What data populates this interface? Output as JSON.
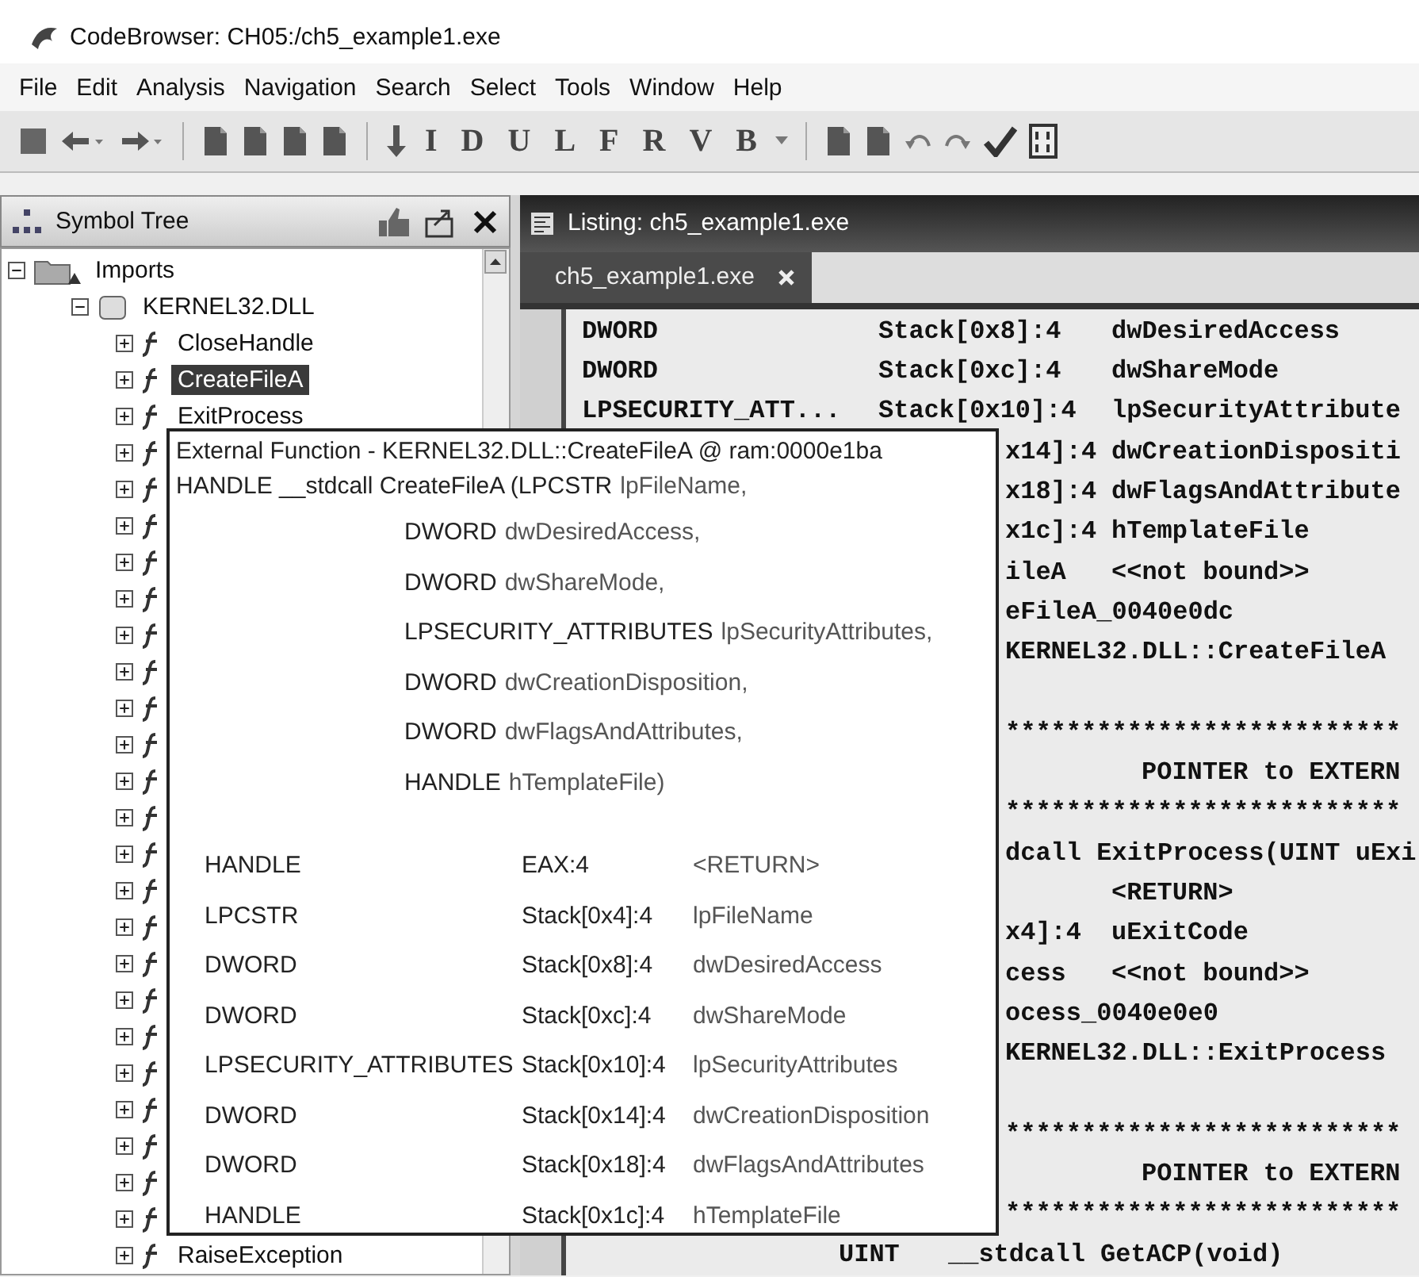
{
  "window": {
    "title": "CodeBrowser: CH05:/ch5_example1.exe"
  },
  "menu": [
    "File",
    "Edit",
    "Analysis",
    "Navigation",
    "Search",
    "Select",
    "Tools",
    "Window",
    "Help"
  ],
  "toolbar": {
    "letters": [
      "I",
      "D",
      "U",
      "L",
      "F",
      "R",
      "V",
      "B"
    ]
  },
  "symbol_tree": {
    "title": "Symbol Tree",
    "items": [
      {
        "label": "Imports",
        "expanded": true,
        "selected": false,
        "children": [
          {
            "label": "KERNEL32.DLL",
            "expanded": true,
            "selected": false,
            "children": [
              {
                "label": "CloseHandle",
                "expanded": false,
                "selected": false
              },
              {
                "label": "CreateFileA",
                "expanded": false,
                "selected": true
              },
              {
                "label": "ExitProcess",
                "expanded": false,
                "selected": false
              },
              {
                "expanded": false
              },
              {
                "expanded": false
              },
              {
                "expanded": false
              },
              {
                "expanded": false
              },
              {
                "expanded": false
              },
              {
                "expanded": false
              },
              {
                "expanded": false
              },
              {
                "expanded": false
              },
              {
                "expanded": false
              },
              {
                "expanded": false
              },
              {
                "expanded": false
              },
              {
                "expanded": false
              },
              {
                "expanded": false
              },
              {
                "expanded": false
              },
              {
                "expanded": false
              },
              {
                "expanded": false
              },
              {
                "expanded": false
              },
              {
                "expanded": false
              },
              {
                "expanded": false
              },
              {
                "expanded": false
              },
              {
                "expanded": false
              },
              {
                "expanded": false
              },
              {
                "label": "RaiseException",
                "expanded": false,
                "selected": false
              }
            ]
          }
        ]
      }
    ]
  },
  "listing": {
    "title": "Listing:  ch5_example1.exe",
    "tabs": [
      {
        "label": "ch5_example1.exe",
        "selected": true
      }
    ],
    "lines": [
      {
        "kind": "param",
        "type": "DWORD",
        "storage": "Stack[0x8]:4",
        "name": "dwDesiredAccess"
      },
      {
        "kind": "param",
        "type": "DWORD",
        "storage": "Stack[0xc]:4",
        "name": "dwShareMode"
      },
      {
        "kind": "param",
        "type": "LPSECURITY_ATT...",
        "storage": "Stack[0x10]:4",
        "name": "lpSecurityAttribute"
      },
      {
        "kind": "tail",
        "storage": "x14]:4",
        "name": "dwCreationDispositi"
      },
      {
        "kind": "tail",
        "storage": "x18]:4",
        "name": "dwFlagsAndAttribute"
      },
      {
        "kind": "tail",
        "storage": "x1c]:4",
        "name": "hTemplateFile"
      },
      {
        "kind": "tail",
        "storage": "ileA",
        "name": "<<not bound>>"
      },
      {
        "kind": "text",
        "text": "eFileA_0040e0dc"
      },
      {
        "kind": "text",
        "text": "KERNEL32.DLL::CreateFileA"
      },
      {
        "kind": "blank"
      },
      {
        "kind": "stars",
        "text": "**************************"
      },
      {
        "kind": "heading",
        "text": "POINTER to EXTERN"
      },
      {
        "kind": "stars",
        "text": "**************************"
      },
      {
        "kind": "text",
        "text": "dcall ExitProcess(UINT uExi"
      },
      {
        "kind": "name",
        "name": "<RETURN>"
      },
      {
        "kind": "tail",
        "storage": "x4]:4",
        "name": "uExitCode"
      },
      {
        "kind": "tail",
        "storage": "cess",
        "name": "<<not bound>>"
      },
      {
        "kind": "text",
        "text": "ocess_0040e0e0"
      },
      {
        "kind": "text",
        "text": "KERNEL32.DLL::ExitProcess"
      },
      {
        "kind": "blank"
      },
      {
        "kind": "stars",
        "text": "**************************"
      },
      {
        "kind": "heading",
        "text": "POINTER to EXTERN"
      },
      {
        "kind": "stars",
        "text": "**************************"
      },
      {
        "kind": "code",
        "type": "UINT",
        "text": "__stdcall GetACP(void)"
      }
    ]
  },
  "tooltip": {
    "header": "External Function - KERNEL32.DLL::CreateFileA @ ram:0000e1ba",
    "signature": "HANDLE __stdcall CreateFileA (",
    "params": [
      {
        "type": "LPCSTR",
        "name": "lpFileName,"
      },
      {
        "type": "DWORD",
        "name": "dwDesiredAccess,"
      },
      {
        "type": "DWORD",
        "name": "dwShareMode,"
      },
      {
        "type": "LPSECURITY_ATTRIBUTES",
        "name": "lpSecurityAttributes,"
      },
      {
        "type": "DWORD",
        "name": "dwCreationDisposition,"
      },
      {
        "type": "DWORD",
        "name": "dwFlagsAndAttributes,"
      },
      {
        "type": "HANDLE",
        "name": "hTemplateFile)"
      }
    ],
    "table": [
      {
        "type": "HANDLE",
        "storage": "EAX:4",
        "name": "<RETURN>"
      },
      {
        "type": "LPCSTR",
        "storage": "Stack[0x4]:4",
        "name": "lpFileName"
      },
      {
        "type": "DWORD",
        "storage": "Stack[0x8]:4",
        "name": "dwDesiredAccess"
      },
      {
        "type": "DWORD",
        "storage": "Stack[0xc]:4",
        "name": "dwShareMode"
      },
      {
        "type": "LPSECURITY_ATTRIBUTES",
        "storage": "Stack[0x10]:4",
        "name": "lpSecurityAttributes"
      },
      {
        "type": "DWORD",
        "storage": "Stack[0x14]:4",
        "name": "dwCreationDisposition"
      },
      {
        "type": "DWORD",
        "storage": "Stack[0x18]:4",
        "name": "dwFlagsAndAttributes"
      },
      {
        "type": "HANDLE",
        "storage": "Stack[0x1c]:4",
        "name": "hTemplateFile"
      }
    ]
  }
}
